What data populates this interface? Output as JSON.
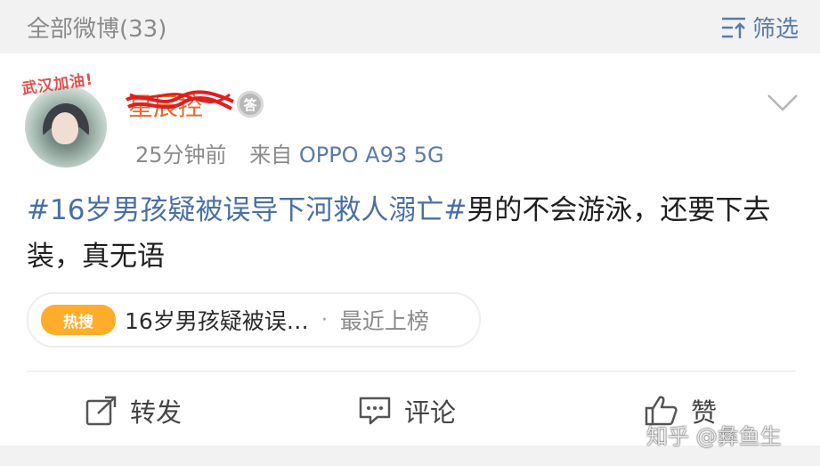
{
  "header": {
    "weibo_count": "全部微博(33)",
    "filter_label": "筛选",
    "filter_icon": "filter-icon"
  },
  "post": {
    "avatar_tag": "武汉加油!",
    "username": "星辰控",
    "badge_text": "答",
    "time": "25分钟前",
    "source_prefix": "来自",
    "device": "OPPO A93 5G",
    "hashtag": "#16岁男孩疑被误导下河救人溺亡#",
    "body": "男的不会游泳，还要下去装，真无语"
  },
  "hot_search": {
    "badge": "热搜",
    "title": "16岁男孩疑被误…",
    "separator": "·",
    "rank_label": "最近上榜"
  },
  "actions": {
    "repost": "转发",
    "comment": "评论",
    "like": "赞"
  },
  "watermark": "知乎 @彝鱼生",
  "colors": {
    "link_blue": "#4a6fa5",
    "hot_orange": "#ffad2a",
    "username_orange": "#e56a2c",
    "scribble_red": "#e01e1e"
  }
}
